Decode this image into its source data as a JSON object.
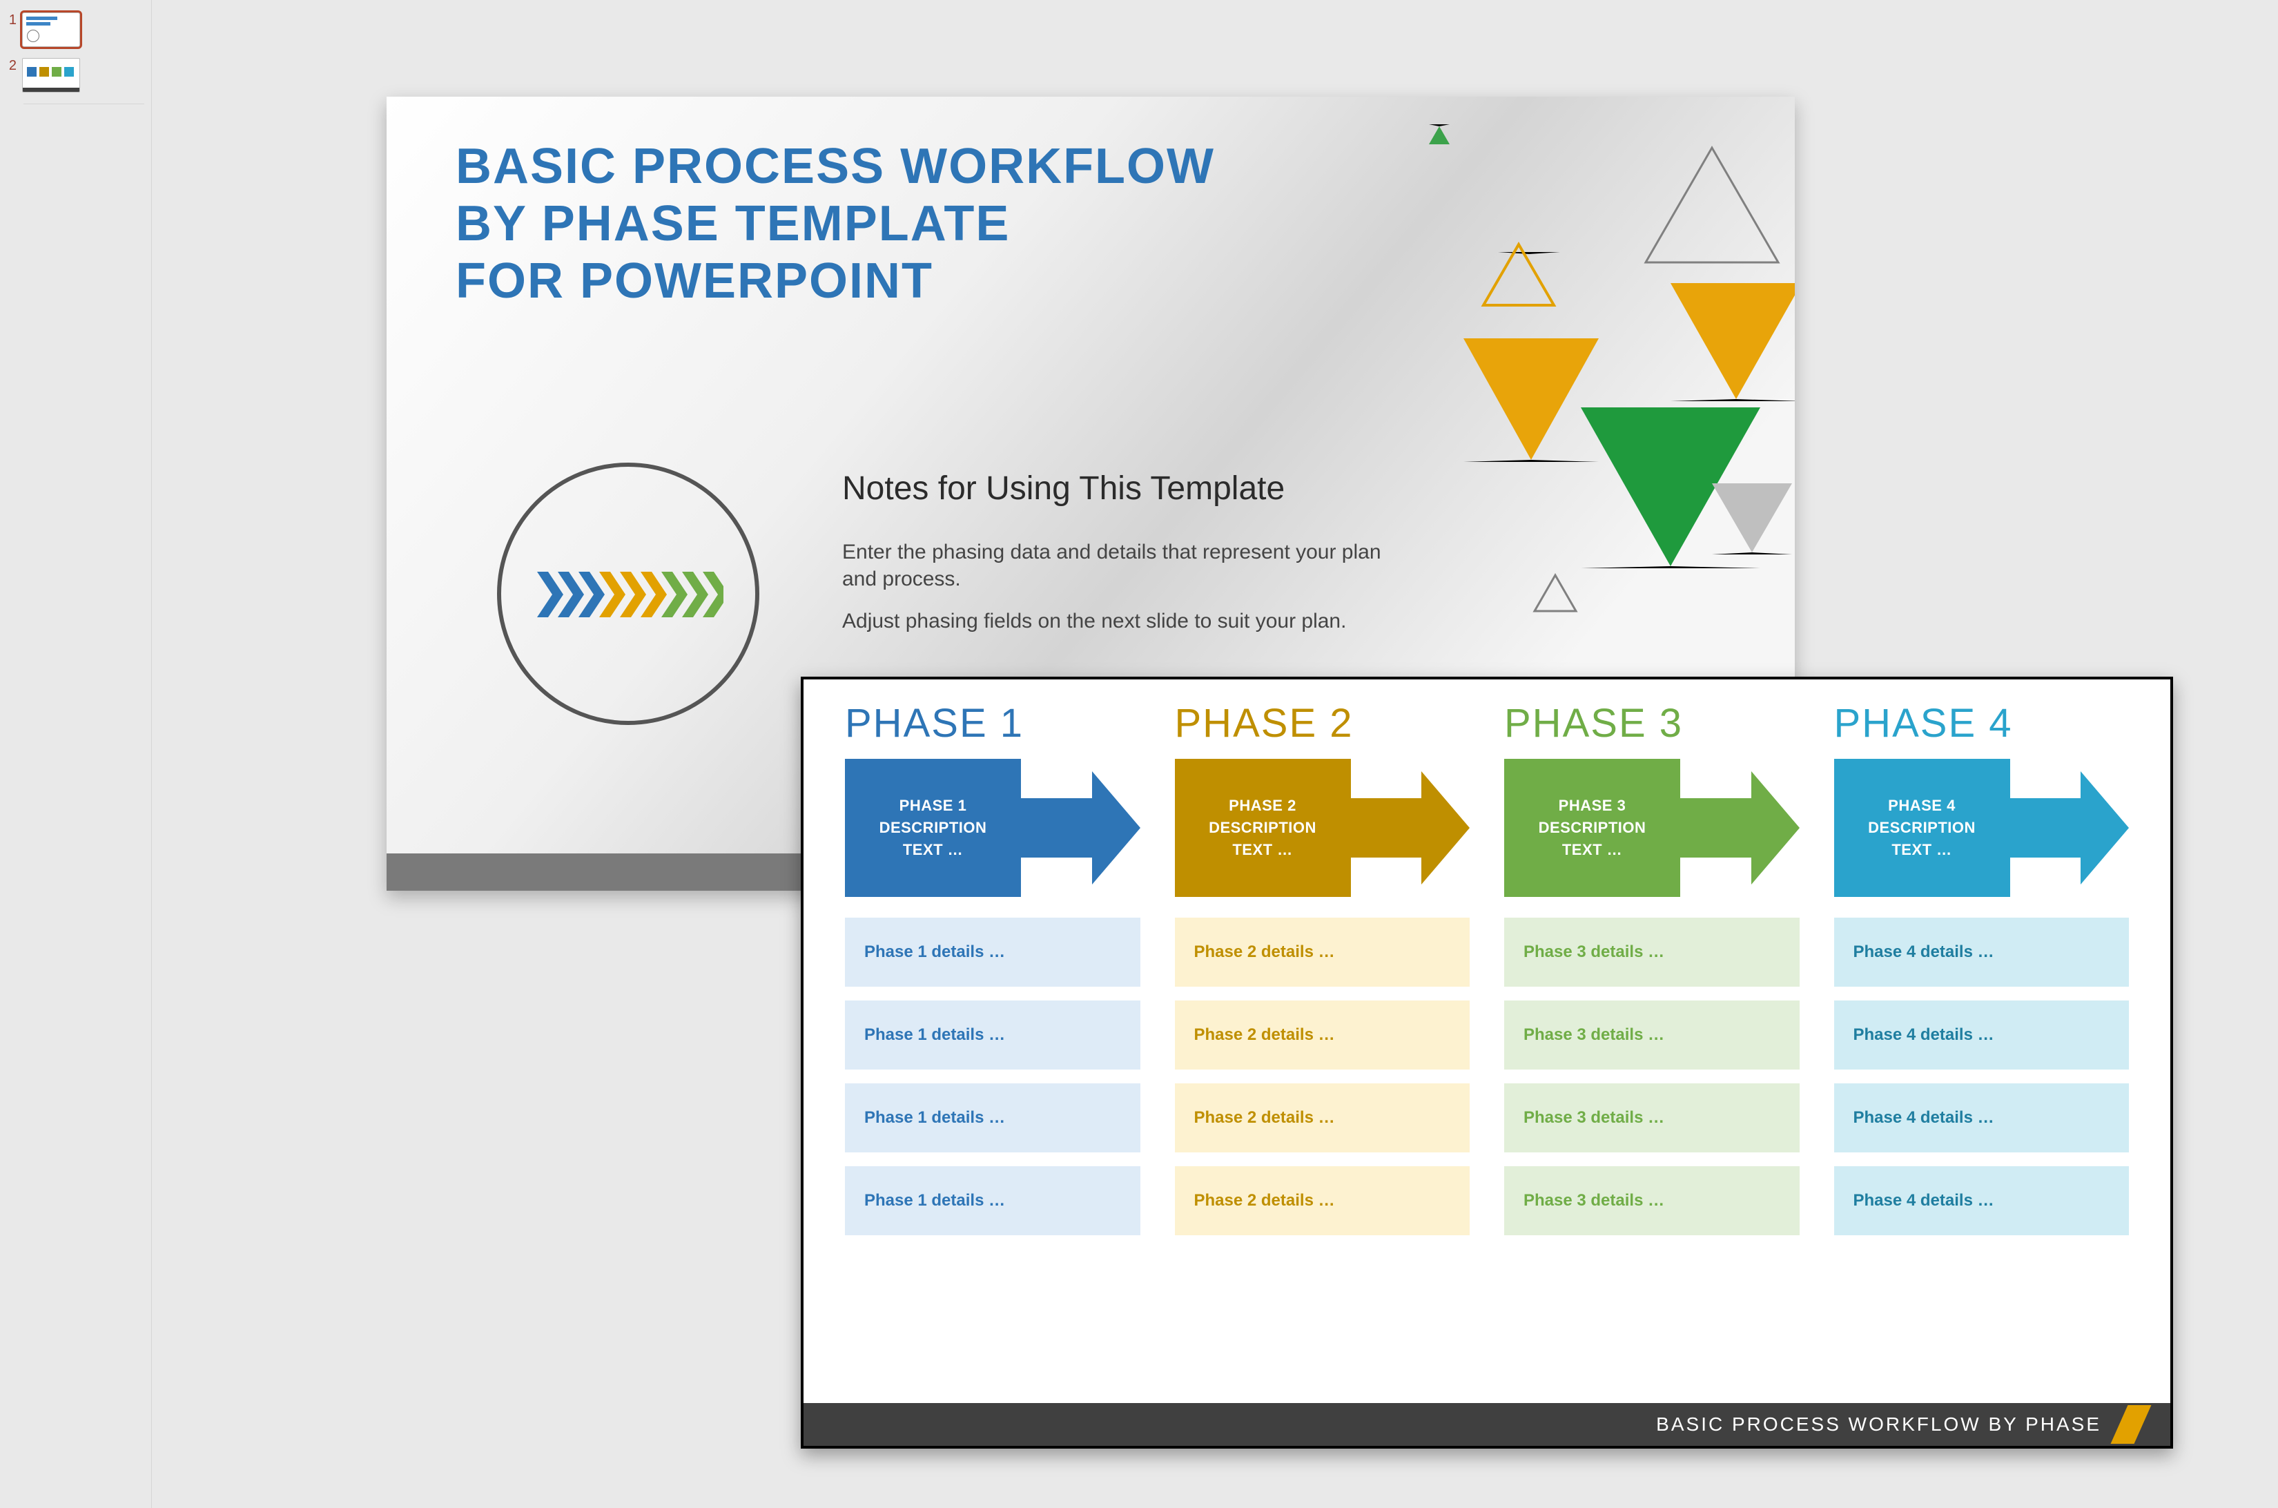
{
  "thumbnails": [
    {
      "num": "1",
      "selected": true
    },
    {
      "num": "2",
      "selected": false
    }
  ],
  "slide1": {
    "title_line1": "BASIC PROCESS WORKFLOW",
    "title_line2": "BY PHASE TEMPLATE",
    "title_line3": "FOR POWERPOINT",
    "subtitle": "Notes for Using This Template",
    "body1": "Enter the phasing data and details that represent your plan and process.",
    "body2": "Adjust phasing fields on the next slide to suit your plan."
  },
  "slide2": {
    "footer": "BASIC PROCESS WORKFLOW BY PHASE",
    "phases": [
      {
        "head": "PHASE 1",
        "box_l1": "PHASE 1",
        "box_l2": "DESCRIPTION",
        "box_l3": "TEXT …",
        "details": [
          "Phase 1 details …",
          "Phase 1 details …",
          "Phase 1 details …",
          "Phase 1 details …"
        ]
      },
      {
        "head": "PHASE 2",
        "box_l1": "PHASE 2",
        "box_l2": "DESCRIPTION",
        "box_l3": "TEXT …",
        "details": [
          "Phase 2 details …",
          "Phase 2 details …",
          "Phase 2 details …",
          "Phase 2 details …"
        ]
      },
      {
        "head": "PHASE 3",
        "box_l1": "PHASE 3",
        "box_l2": "DESCRIPTION",
        "box_l3": "TEXT …",
        "details": [
          "Phase 3 details …",
          "Phase 3 details …",
          "Phase 3 details …",
          "Phase 3 details …"
        ]
      },
      {
        "head": "PHASE 4",
        "box_l1": "PHASE 4",
        "box_l2": "DESCRIPTION",
        "box_l3": "TEXT …",
        "details": [
          "Phase 4 details …",
          "Phase 4 details …",
          "Phase 4 details …",
          "Phase 4 details …"
        ]
      }
    ]
  }
}
